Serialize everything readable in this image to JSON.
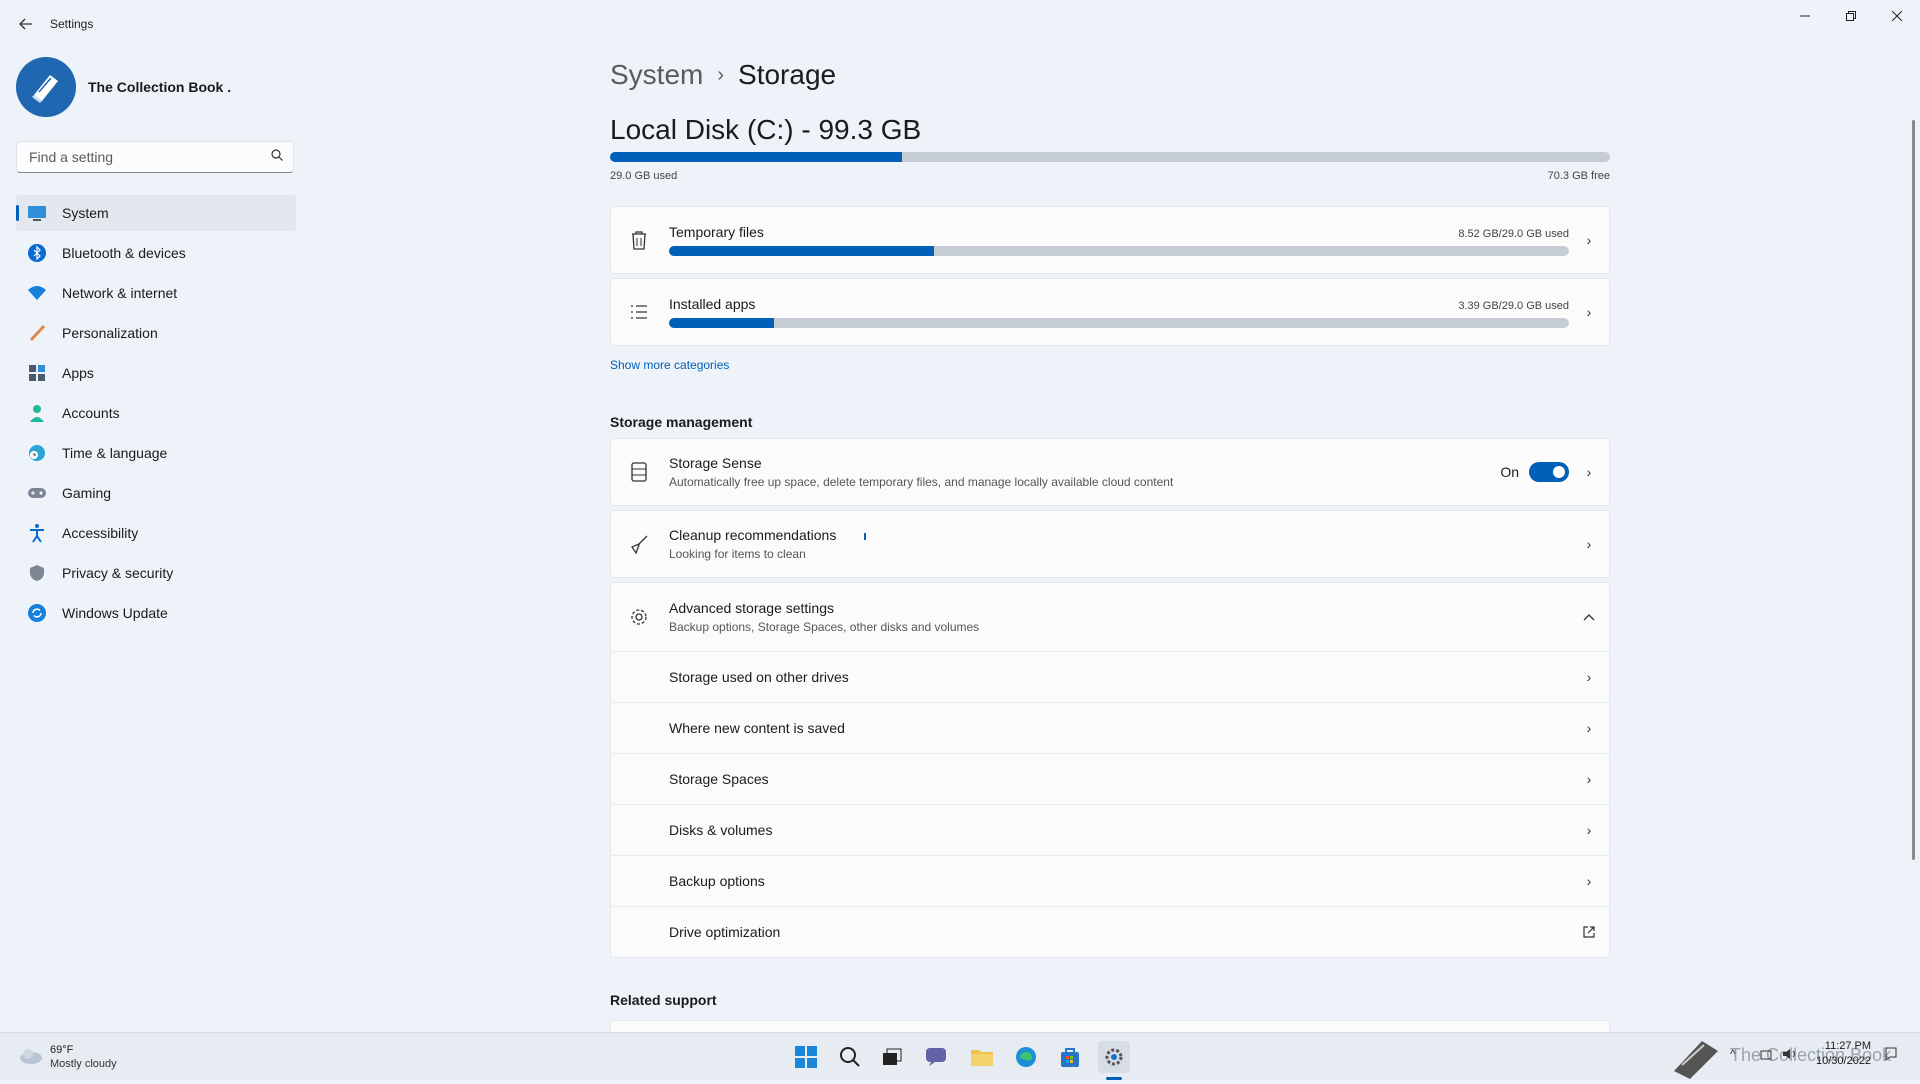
{
  "window": {
    "title": "Settings",
    "back_label": "Back",
    "minimize": "–",
    "maximize": "❐",
    "close": "✕"
  },
  "user": {
    "name": "The Collection Book ."
  },
  "search": {
    "placeholder": "Find a setting"
  },
  "nav": {
    "items": [
      {
        "label": "System",
        "icon": "monitor-icon",
        "active": true
      },
      {
        "label": "Bluetooth & devices",
        "icon": "bluetooth-icon"
      },
      {
        "label": "Network & internet",
        "icon": "wifi-icon"
      },
      {
        "label": "Personalization",
        "icon": "brush-icon"
      },
      {
        "label": "Apps",
        "icon": "apps-icon"
      },
      {
        "label": "Accounts",
        "icon": "person-icon"
      },
      {
        "label": "Time & language",
        "icon": "globe-clock-icon"
      },
      {
        "label": "Gaming",
        "icon": "gamepad-icon"
      },
      {
        "label": "Accessibility",
        "icon": "accessibility-icon"
      },
      {
        "label": "Privacy & security",
        "icon": "shield-icon"
      },
      {
        "label": "Windows Update",
        "icon": "update-icon"
      }
    ]
  },
  "breadcrumb": {
    "parent": "System",
    "separator": "›",
    "current": "Storage"
  },
  "disk": {
    "title": "Local Disk (C:) - 99.3 GB",
    "used_label": "29.0 GB used",
    "free_label": "70.3 GB free",
    "used_fraction": 0.292
  },
  "categories": [
    {
      "title": "Temporary files",
      "usage": "8.52 GB/29.0 GB used",
      "fraction": 0.294,
      "icon": "trash-icon"
    },
    {
      "title": "Installed apps",
      "usage": "3.39 GB/29.0 GB used",
      "fraction": 0.117,
      "icon": "list-icon"
    }
  ],
  "show_more": "Show more categories",
  "storage_management": {
    "heading": "Storage management",
    "sense": {
      "title": "Storage Sense",
      "subtitle": "Automatically free up space, delete temporary files, and manage locally available cloud content",
      "state": "On"
    },
    "cleanup": {
      "title": "Cleanup recommendations",
      "subtitle": "Looking for items to clean"
    },
    "advanced": {
      "title": "Advanced storage settings",
      "subtitle": "Backup options, Storage Spaces, other disks and volumes",
      "items": [
        "Storage used on other drives",
        "Where new content is saved",
        "Storage Spaces",
        "Disks & volumes",
        "Backup options",
        "Drive optimization"
      ]
    }
  },
  "related_support": "Related support",
  "weather": {
    "temp": "69°F",
    "condition": "Mostly cloudy"
  },
  "tray": {
    "time": "11:27 PM",
    "date": "10/30/2022",
    "watermark": "The Collection Book"
  },
  "colors": {
    "accent": "#005fb8",
    "bar_track": "#c6ccd3"
  }
}
